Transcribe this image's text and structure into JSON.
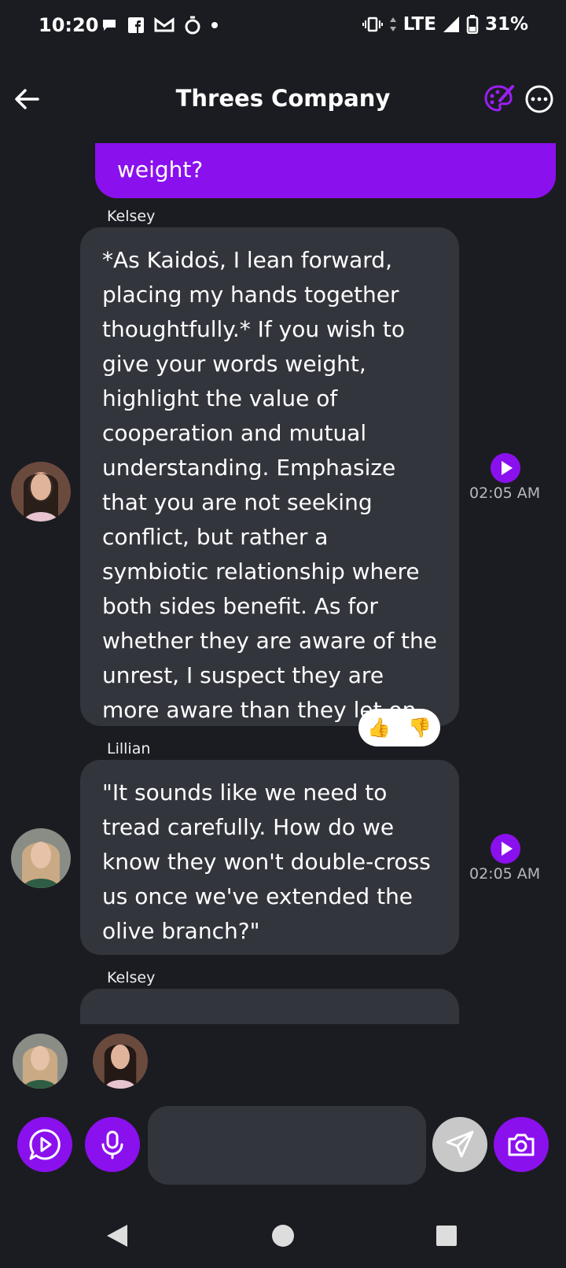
{
  "status_bar": {
    "time": "10:20",
    "network": "LTE",
    "battery": "31%"
  },
  "header": {
    "title": "Threes Company"
  },
  "messages": {
    "user_partial_text": "weight?",
    "m1": {
      "sender": "Kelsey",
      "text": "*As Kaidoṡ, I lean forward, placing my hands together thoughtfully.* If you wish to give your words weight, highlight the value of cooperation and mutual understanding. Emphasize that you are not seeking conflict, but rather a symbiotic relationship where both sides benefit. As for whether they are aware of the unrest, I suspect they are more aware than they let on.",
      "time": "02:05 AM",
      "reaction_up": "👍",
      "reaction_down": "👎"
    },
    "m2": {
      "sender": "Lillian",
      "text": "\"It sounds like we need to tread carefully. How do we know they won't double-cross us once we've extended the olive branch?\"",
      "time": "02:05 AM"
    },
    "m3": {
      "sender": "Kelsey"
    }
  },
  "composer": {
    "value": ""
  },
  "colors": {
    "accent": "#8b10ee",
    "background": "#1b1c21",
    "bubble": "#33353d"
  }
}
